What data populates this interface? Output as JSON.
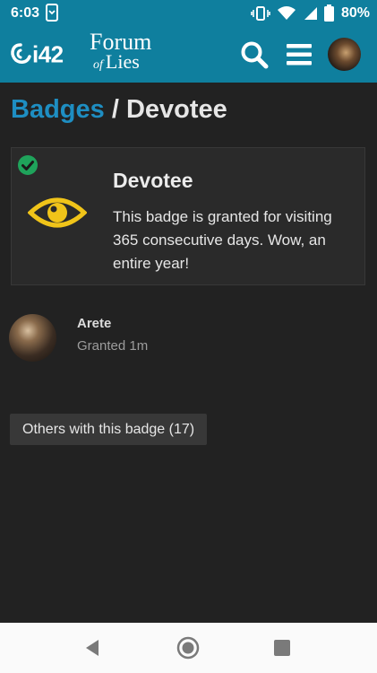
{
  "status_bar": {
    "time": "6:03",
    "battery": "80%",
    "icons": [
      "screenshot-app-icon",
      "vibrate-icon",
      "wifi-icon",
      "signal-icon",
      "battery-icon"
    ]
  },
  "header": {
    "logo_i42": "i42",
    "logo_forum": "Forum",
    "logo_of": "of",
    "logo_lies": "Lies",
    "icons": [
      "search-icon",
      "menu-icon",
      "user-avatar"
    ],
    "colors": {
      "bar": "#0f7f9e"
    }
  },
  "breadcrumb": {
    "link": "Badges",
    "separator": "/",
    "current": "Devotee"
  },
  "badge": {
    "title": "Devotee",
    "description": "This badge is granted for visiting 365 consecutive days. Wow, an entire year!",
    "icon": "eye-icon",
    "granted_indicator": "check-icon",
    "colors": {
      "eye": "#f0c419",
      "check": "#1fa35b"
    }
  },
  "grant": {
    "username": "Arete",
    "granted": "Granted 1m"
  },
  "others_button": "Others with this badge (17)",
  "nav": {
    "icons": [
      "back-icon",
      "home-icon",
      "recents-icon"
    ]
  },
  "colors": {
    "background": "#222222",
    "link": "#1e8ec2"
  }
}
